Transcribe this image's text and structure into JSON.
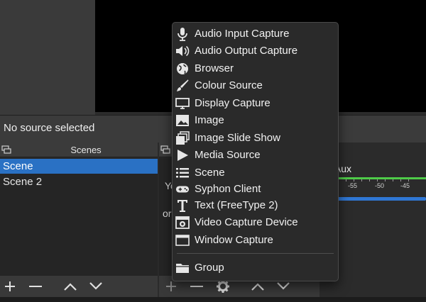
{
  "source_bar": {
    "text": "No source selected"
  },
  "scenes": {
    "title": "Scenes",
    "items": [
      {
        "label": "Scene",
        "selected": true
      },
      {
        "label": "Scene 2",
        "selected": false
      }
    ]
  },
  "sources": {
    "hint_line1": "Yo",
    "hint_line2": "or"
  },
  "mixer": {
    "label": "c/Aux",
    "ticks": [
      "-55",
      "-50",
      "-45"
    ]
  },
  "context_menu": {
    "items": [
      {
        "label": "Audio Input Capture",
        "icon": "microphone-icon"
      },
      {
        "label": "Audio Output Capture",
        "icon": "speaker-icon"
      },
      {
        "label": "Browser",
        "icon": "globe-icon"
      },
      {
        "label": "Colour Source",
        "icon": "paintbrush-icon"
      },
      {
        "label": "Display Capture",
        "icon": "monitor-icon"
      },
      {
        "label": "Image",
        "icon": "image-icon"
      },
      {
        "label": "Image Slide Show",
        "icon": "image-stack-icon"
      },
      {
        "label": "Media Source",
        "icon": "play-icon"
      },
      {
        "label": "Scene",
        "icon": "list-icon"
      },
      {
        "label": "Syphon Client",
        "icon": "gamepad-icon"
      },
      {
        "label": "Text (FreeType 2)",
        "icon": "text-icon"
      },
      {
        "label": "Video Capture Device",
        "icon": "camera-icon"
      },
      {
        "label": "Window Capture",
        "icon": "window-icon"
      }
    ],
    "group": {
      "label": "Group",
      "icon": "folder-icon"
    }
  },
  "colors": {
    "accent": "#2a71c4",
    "meter_green": "#4ecb48",
    "slider_blue": "#2f77d4"
  }
}
